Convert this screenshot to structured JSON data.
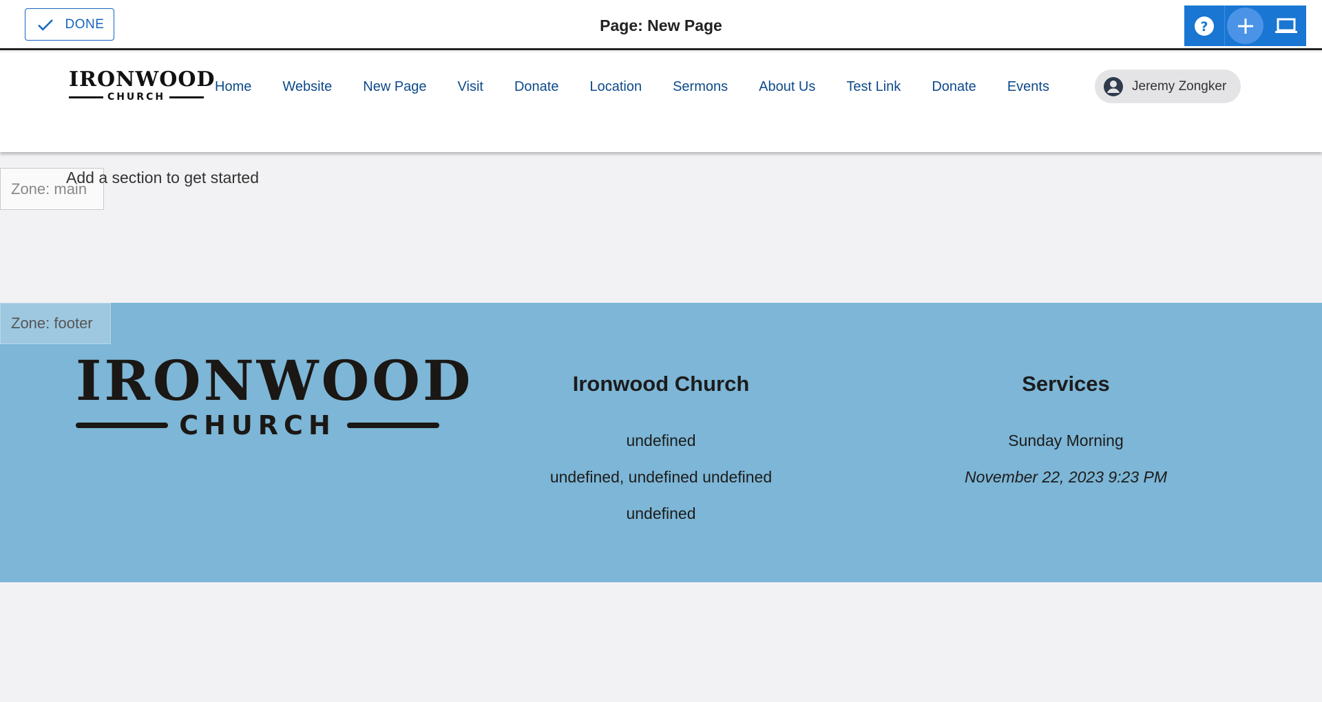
{
  "editor": {
    "done_label": "DONE",
    "page_title": "Page: New Page",
    "tools": [
      "help-icon",
      "add-icon",
      "laptop-icon"
    ]
  },
  "header": {
    "logo": {
      "word": "IRONWOOD",
      "sub": "CHURCH"
    },
    "nav": [
      "Home",
      "Website",
      "New Page",
      "Visit",
      "Donate",
      "Location",
      "Sermons",
      "About Us",
      "Test Link",
      "Donate",
      "Events"
    ],
    "user_name": "Jeremy Zongker"
  },
  "main": {
    "zone_label": "Zone: main",
    "empty_hint": "Add a section to get started"
  },
  "footer": {
    "zone_label": "Zone: footer",
    "logo": {
      "word": "IRONWOOD",
      "sub": "CHURCH"
    },
    "church": {
      "title": "Ironwood Church",
      "lines": [
        "undefined",
        "undefined, undefined undefined",
        "undefined"
      ]
    },
    "services": {
      "title": "Services",
      "name": "Sunday Morning",
      "datetime": "November 22, 2023 9:23 PM"
    }
  },
  "colors": {
    "accent": "#1976d2",
    "nav_text": "#0d4a8a",
    "footer_bg": "#7db6d6",
    "page_bg": "#f2f2f4"
  }
}
